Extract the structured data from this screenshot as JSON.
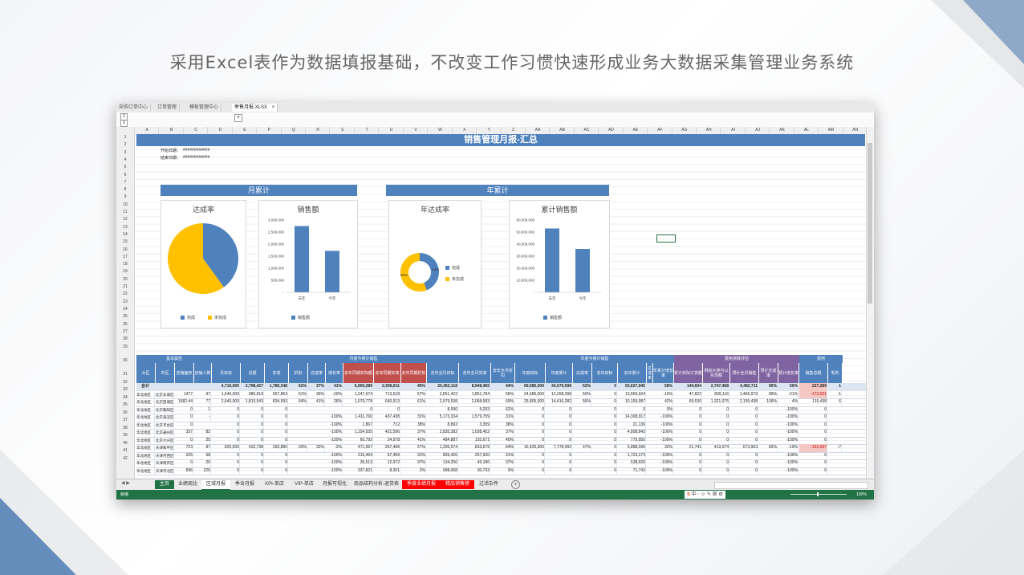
{
  "headline": "采用Excel表作为数据填报基础，不改变工作习惯快速形成业务大数据采集管理业务系统",
  "colors": {
    "accent_blue": "#4f81bd",
    "accent_gold": "#ffc000",
    "excel_green": "#217346",
    "purple": "#8064a2",
    "red_tab": "#ff0000"
  },
  "file_tabs": [
    "采购订单中心",
    "订单管理",
    "模板管理中心",
    "季售月报.XLSX"
  ],
  "close_icon": "×",
  "column_letters": [
    "A",
    "B",
    "C",
    "D",
    "E",
    "P",
    "Q",
    "R",
    "S",
    "T",
    "U",
    "V",
    "W",
    "X",
    "Y",
    "Z",
    "AA",
    "AB",
    "AC",
    "AD",
    "AE",
    "AF",
    "AG",
    "AH",
    "AI",
    "AJ",
    "AK",
    "AL",
    "AM",
    "AN"
  ],
  "row_numbers": [
    "1",
    "2",
    "3",
    "4",
    "5",
    "6",
    "7",
    "8",
    "9",
    "10",
    "11",
    "12",
    "13",
    "14",
    "15",
    "16",
    "17",
    "18",
    "19",
    "20",
    "21",
    "22",
    "23",
    "24",
    "25",
    "26",
    "27",
    "28",
    "29",
    "30",
    "31",
    "32",
    "33",
    "34",
    "35",
    "36",
    "37",
    "38",
    "39",
    "40",
    "41",
    "42"
  ],
  "report": {
    "title": "销售管理月报-汇总",
    "start_label": "开始日期：",
    "start_value": "############",
    "end_label": "结束日期：",
    "end_value": "############",
    "monthly_banner": "月累计",
    "yearly_banner": "年累计"
  },
  "chart_data": [
    {
      "type": "pie",
      "title": "达成率",
      "categories": [
        "完成",
        "未完成"
      ],
      "values": [
        40,
        60
      ],
      "colors": [
        "#4f81bd",
        "#ffc000"
      ],
      "legend": "bottom"
    },
    {
      "type": "bar",
      "title": "销售额",
      "categories": [
        "去年",
        "今年"
      ],
      "values": [
        2750000,
        1720000
      ],
      "yticks": [
        "3,000,000",
        "2,500,000",
        "2,000,000",
        "1,500,000",
        "1,000,000",
        "500,000",
        "-"
      ],
      "ylim": [
        0,
        3000000
      ],
      "legend_entries": [
        "销售额"
      ],
      "color": "#4f81bd"
    },
    {
      "type": "pie",
      "title": "年达成率",
      "categories": [
        "完成",
        "未完成"
      ],
      "values": [
        44,
        56
      ],
      "colors": [
        "#4f81bd",
        "#ffc000"
      ],
      "data_labels": [
        "44%",
        "56%"
      ],
      "donut": true,
      "legend": "right"
    },
    {
      "type": "bar",
      "title": "累计销售额",
      "categories": [
        "去年",
        "今年"
      ],
      "values": [
        53000000,
        36000000
      ],
      "yticks": [
        "60,000,000",
        "50,000,000",
        "40,000,000",
        "30,000,000",
        "20,000,000",
        "10,000,000",
        "-"
      ],
      "ylim": [
        0,
        60000000
      ],
      "legend_entries": [
        "销售额"
      ],
      "color": "#4f81bd"
    }
  ],
  "table": {
    "group_headers": [
      "基本属性",
      "月度今累计销售",
      "年度今累计销售",
      "费用测算评估",
      "费用"
    ],
    "sub_headers": [
      "大区",
      "中区",
      "店铺面积",
      "店铺人数",
      "月目标",
      "总额",
      "实收",
      "折扣",
      "达成率",
      "增长率",
      "去年同期实际额",
      "去年同期实收",
      "去年同期折扣",
      "去年全月目标",
      "去年全月实收",
      "去年全月折扣",
      "年度目标",
      "年度累计",
      "达成率",
      "去年目标",
      "去年累计",
      "达成率",
      "年累计增长率",
      "累计实际订货额",
      "例如大类与以实现额",
      "预计全月销售",
      "预计达成率",
      "预计增长率",
      "销售总额",
      "毛利"
    ],
    "total_row": [
      "合计",
      "",
      "",
      "",
      "4,710,000",
      "2,798,427",
      "1,785,348",
      "62%",
      "37%",
      "41%",
      "6,900,289",
      "2,936,811",
      "45%",
      "20,452,118",
      "8,948,465",
      "44%",
      "69,585,000",
      "34,079,598",
      "52%",
      "0",
      "53,627,945",
      "",
      "58%",
      "144,604",
      "2,747,468",
      "4,482,711",
      "95%",
      "50%",
      "227,289",
      "1"
    ],
    "rows": [
      [
        "华北地区",
        "北京东城区",
        "1477",
        "97",
        "1,640,000",
        "986,819",
        "567,863",
        "61%",
        "35%",
        "-20%",
        "1,247,674",
        "713,518",
        "57%",
        "2,851,422",
        "1,851,784",
        "65%",
        "24,585,000",
        "12,268,398",
        "50%",
        "0",
        "13,669,924",
        "",
        "-10%",
        "47,822",
        "899,116",
        "1,466,979",
        "89%",
        "-21%",
        "-173,021",
        "-1"
      ],
      [
        "华北地区",
        "北京西城区",
        "1682.44",
        "77",
        "2,640,000",
        "1,810,543",
        "834,993",
        "64%",
        "41%",
        "26%",
        "1,079,778",
        "660,913",
        "61%",
        "2,979,538",
        "2,068,583",
        "69%",
        "25,805,000",
        "14,416,282",
        "56%",
        "0",
        "10,159,087",
        "",
        "42%",
        "69,530",
        "1,321,075",
        "2,155,438",
        "106%",
        "4%",
        "115,438",
        "6"
      ],
      [
        "华北地区",
        "北京朝阳区",
        "0",
        "1",
        "0",
        "0",
        "0",
        "",
        "",
        "",
        "0",
        "0",
        "",
        "8,590",
        "5,293",
        "62%",
        "0",
        "0",
        "",
        "0",
        "0",
        "",
        "0%",
        "0",
        "0",
        "0",
        "",
        "-100%",
        "0",
        ""
      ],
      [
        "华北地区",
        "北京海淀区",
        "0",
        "-",
        "0",
        "0",
        "0",
        "",
        "",
        "-100%",
        "1,411,760",
        "437,438",
        "31%",
        "5,173,334",
        "1,579,759",
        "31%",
        "0",
        "0",
        "",
        "0",
        "14,308,917",
        "",
        "-100%",
        "0",
        "0",
        "0",
        "",
        "-100%",
        "0",
        ""
      ],
      [
        "华北地区",
        "北京丰台区",
        "0",
        "",
        "0",
        "0",
        "0",
        "",
        "",
        "-100%",
        "1,867",
        "712",
        "38%",
        "8,892",
        "3,359",
        "38%",
        "0",
        "0",
        "",
        "0",
        "21,136",
        "",
        "-100%",
        "0",
        "0",
        "0",
        "",
        "-100%",
        "0",
        ""
      ],
      [
        "华北地区",
        "北京通州区",
        "337",
        "82",
        "0",
        "0",
        "0",
        "",
        "",
        "-100%",
        "1,154,925",
        "421,596",
        "37%",
        "2,835,382",
        "1,038,452",
        "37%",
        "0",
        "0",
        "",
        "0",
        "4,808,842",
        "",
        "-100%",
        "0",
        "0",
        "0",
        "",
        "-100%",
        "0",
        ""
      ],
      [
        "华北地区",
        "北京大兴区",
        "0",
        "25",
        "0",
        "0",
        "0",
        "",
        "",
        "-100%",
        "60,792",
        "24,978",
        "41%",
        "484,887",
        "192,671",
        "40%",
        "0",
        "0",
        "",
        "0",
        "779,950",
        "",
        "-100%",
        "0",
        "0",
        "0",
        "",
        "-100%",
        "0",
        ""
      ],
      [
        "华北地区",
        "天津和平区",
        "723",
        "87",
        "825,000",
        "432,738",
        "260,880",
        "60%",
        "32%",
        "-2%",
        "471,567",
        "267,468",
        "57%",
        "1,295,574",
        "833,679",
        "64%",
        "16,425,000",
        "7,778,492",
        "47%",
        "0",
        "5,888,096",
        "",
        "32%",
        "21,741",
        "413,074",
        "673,963",
        "82%",
        "-19%",
        "-151,037",
        "-7"
      ],
      [
        "华北地区",
        "天津河西区",
        "225",
        "58",
        "0",
        "0",
        "0",
        "",
        "",
        "-100%",
        "215,454",
        "67,459",
        "31%",
        "826,426",
        "257,920",
        "31%",
        "0",
        "0",
        "",
        "0",
        "1,723,273",
        "",
        "-100%",
        "0",
        "0",
        "0",
        "",
        "-100%",
        "0",
        ""
      ],
      [
        "华北地区",
        "天津南开区",
        "0",
        "20",
        "0",
        "0",
        "0",
        "",
        "",
        "-100%",
        "35,513",
        "12,972",
        "37%",
        "134,250",
        "49,186",
        "37%",
        "0",
        "0",
        "",
        "0",
        "538,920",
        "",
        "-100%",
        "0",
        "0",
        "0",
        "",
        "-100%",
        "0",
        ""
      ],
      [
        "华北地区",
        "天津河北区",
        "596",
        "226",
        "0",
        "0",
        "0",
        "",
        "",
        "-100%",
        "337,821",
        "8,301",
        "2%",
        "998,068",
        "30,733",
        "3%",
        "0",
        "0",
        "",
        "0",
        "71,742",
        "",
        "-100%",
        "0",
        "0",
        "0",
        "",
        "-100%",
        "0",
        ""
      ]
    ]
  },
  "sheet_tabs": [
    "主页",
    "业绩周比",
    "区域月报",
    "季含月报",
    "KPI-单店",
    "VIP-单店",
    "月报可视化",
    "商品结构分析-退货表",
    "季度业绩月报",
    "精品销售榜",
    "过活杂件"
  ],
  "status": {
    "ready": "就绪",
    "zoom": "100%",
    "ime_label": "中"
  }
}
